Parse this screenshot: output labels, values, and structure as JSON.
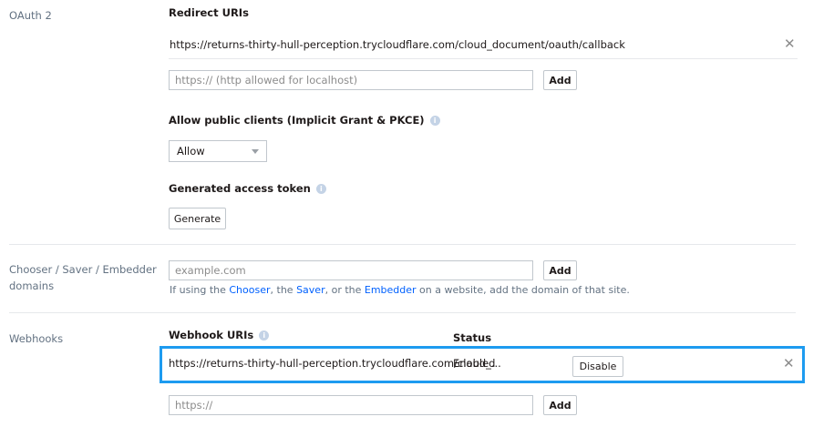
{
  "oauth": {
    "section_label": "OAuth 2",
    "redirect_heading": "Redirect URIs",
    "redirect_uri_value": "https://returns-thirty-hull-perception.trycloudflare.com/cloud_document/oauth/callback",
    "redirect_input_placeholder": "https:// (http allowed for localhost)",
    "add_label": "Add",
    "public_clients_heading": "Allow public clients (Implicit Grant & PKCE)",
    "public_clients_selected": "Allow",
    "access_token_heading": "Generated access token",
    "generate_label": "Generate"
  },
  "chooser": {
    "section_label_line1": "Chooser / Saver / Embedder",
    "section_label_line2": "domains",
    "input_placeholder": "example.com",
    "add_label": "Add",
    "help_prefix": "If using the ",
    "help_chooser": "Chooser",
    "help_sep1": ", the ",
    "help_saver": "Saver",
    "help_sep2": ", or the ",
    "help_embedder": "Embedder",
    "help_suffix": " on a website, add the domain of that site."
  },
  "webhooks": {
    "section_label": "Webhooks",
    "uris_heading": "Webhook URIs",
    "status_heading": "Status",
    "row_uri": "https://returns-thirty-hull-perception.trycloudflare.com/cloud_...",
    "row_status": "Enabled",
    "disable_label": "Disable",
    "input_placeholder": "https://",
    "add_label": "Add"
  },
  "icons": {
    "info": "info-icon",
    "remove": "close-icon",
    "dropdown": "chevron-down-icon"
  },
  "colors": {
    "link": "#0061fe",
    "highlight": "#1d9bf0"
  }
}
